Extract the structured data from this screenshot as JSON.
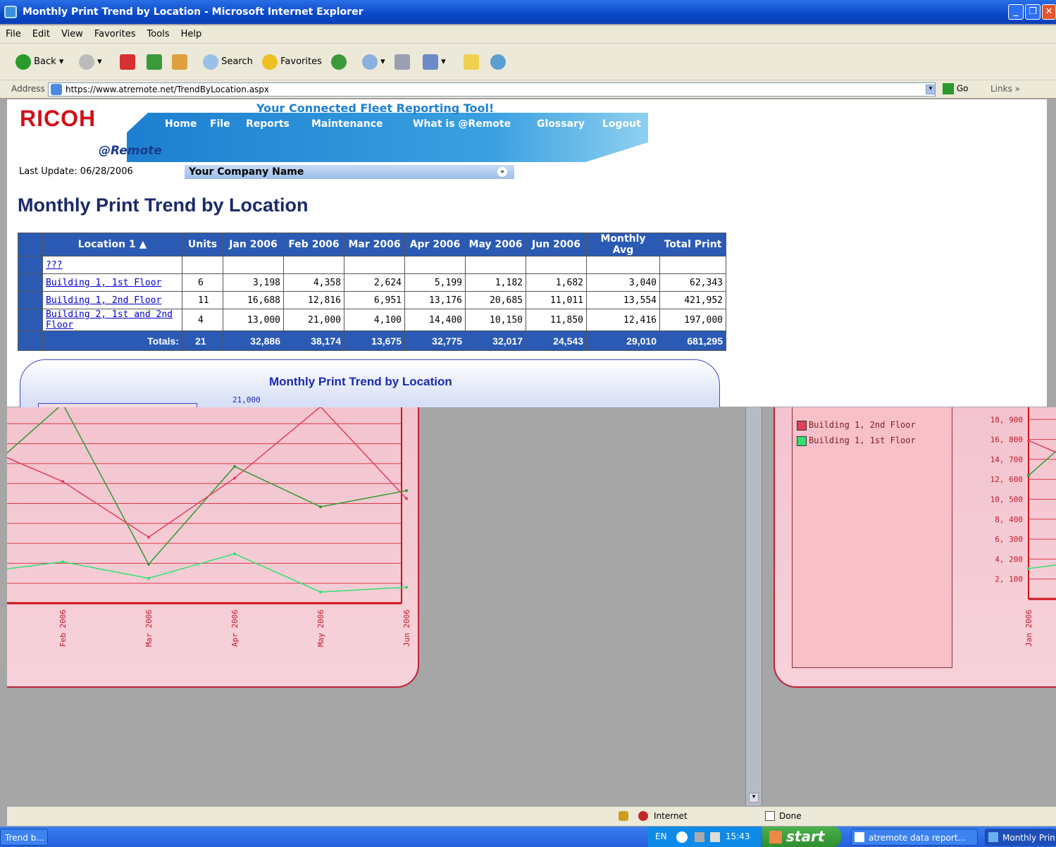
{
  "window": {
    "title": "Monthly Print Trend by Location - Microsoft Internet Explorer"
  },
  "menu": [
    "File",
    "Edit",
    "View",
    "Favorites",
    "Tools",
    "Help"
  ],
  "toolbar": {
    "back": "Back",
    "search": "Search",
    "favorites": "Favorites"
  },
  "address": {
    "label": "Address",
    "url": "https://www.atremote.net/TrendByLocation.aspx",
    "go": "Go",
    "links": "Links"
  },
  "site": {
    "brand": "RICOH",
    "sub_brand": "@Remote",
    "tagline": "Your Connected Fleet Reporting Tool!",
    "nav": [
      "Home",
      "File",
      "Reports",
      "Maintenance",
      "What is @Remote",
      "Glossary",
      "Logout"
    ],
    "last_update": "Last Update: 06/28/2006",
    "company": "Your Company Name"
  },
  "page_title": "Monthly Print Trend by Location",
  "table": {
    "headers": [
      "Location 1",
      "Units",
      "Jan 2006",
      "Feb 2006",
      "Mar 2006",
      "Apr 2006",
      "May 2006",
      "Jun 2006",
      "Monthly Avg",
      "Total Print"
    ],
    "rows": [
      [
        "???",
        "",
        "",
        "",
        "",
        "",
        "",
        "",
        "",
        ""
      ],
      [
        "Building 1, 1st Floor",
        "6",
        "3,198",
        "4,358",
        "2,624",
        "5,199",
        "1,182",
        "1,682",
        "3,040",
        "62,343"
      ],
      [
        "Building 1, 2nd Floor",
        "11",
        "16,688",
        "12,816",
        "6,951",
        "13,176",
        "20,685",
        "11,011",
        "13,554",
        "421,952"
      ],
      [
        "Building 2, 1st and 2nd Floor",
        "4",
        "13,000",
        "21,000",
        "4,100",
        "14,400",
        "10,150",
        "11,850",
        "12,416",
        "197,000"
      ]
    ],
    "totals": [
      "Totals:",
      "21",
      "32,886",
      "38,174",
      "13,675",
      "32,775",
      "32,017",
      "24,543",
      "29,010",
      "681,295"
    ]
  },
  "chart_title": "Monthly Print Trend by Location",
  "chart_top_tick": "21,000",
  "chart_data": {
    "type": "line",
    "title": "Monthly Print Trend by Location",
    "categories": [
      "Jan 2006",
      "Feb 2006",
      "Mar 2006",
      "Apr 2006",
      "May 2006",
      "Jun 2006"
    ],
    "series": [
      {
        "name": "Building 2, 1st and 2nd Floor",
        "values": [
          13000,
          21000,
          4100,
          14400,
          10150,
          11850
        ],
        "color": "#2e9a2e"
      },
      {
        "name": "Building 1, 2nd Floor",
        "values": [
          16688,
          12816,
          6951,
          13176,
          20685,
          11011
        ],
        "color": "#e0405a"
      },
      {
        "name": "Building 1, 1st Floor",
        "values": [
          3198,
          4358,
          2624,
          5199,
          1182,
          1682
        ],
        "color": "#30e070"
      }
    ],
    "y_ticks": [
      "21,000",
      "18,900",
      "16,800",
      "14,700",
      "12,600",
      "10,500",
      "8,400",
      "6,300",
      "4,200",
      "2,100"
    ],
    "ylim": [
      0,
      21000
    ],
    "grid": true
  },
  "right_legend": [
    "Building 1, 2nd Floor",
    "Building 1, 1st Floor"
  ],
  "status": {
    "done": "Done",
    "zone": "Internet"
  },
  "taskbar": {
    "start": "start",
    "lang": "EN",
    "time": "15:43",
    "tasks": [
      "Trend b...",
      "atremote data report...",
      "Monthly Print"
    ]
  }
}
